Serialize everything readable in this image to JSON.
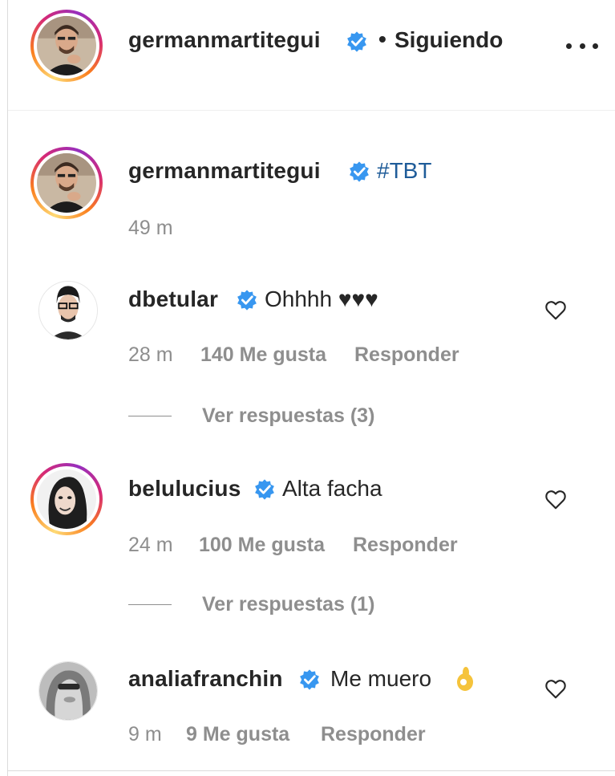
{
  "header": {
    "username": "germanmartitegui",
    "separator": "•",
    "follow_status": "Siguiendo",
    "more_icon": "more-horizontal-icon"
  },
  "caption": {
    "username": "germanmartitegui",
    "text": "#TBT",
    "time": "49 m"
  },
  "comments": [
    {
      "username": "dbetular",
      "text": "Ohhhh ♥♥♥",
      "time": "28 m",
      "likes": "140 Me gusta",
      "reply": "Responder",
      "view_replies": "Ver respuestas (3)"
    },
    {
      "username": "belulucius",
      "text": "Alta facha",
      "time": "24 m",
      "likes": "100 Me gusta",
      "reply": "Responder",
      "view_replies": "Ver respuestas (1)"
    },
    {
      "username": "analiafranchin",
      "text": "Me muero",
      "emoji": "👌",
      "time": "9 m",
      "likes": "9 Me gusta",
      "reply": "Responder"
    }
  ],
  "colors": {
    "verified": "#3897f0",
    "muted": "#8e8e8e",
    "hashtag": "#1f5c99",
    "text": "#262626"
  }
}
